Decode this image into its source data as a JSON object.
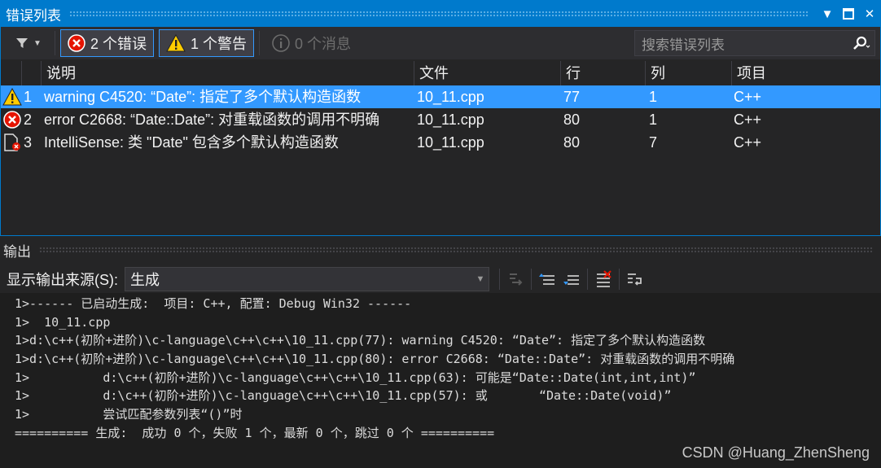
{
  "error_list": {
    "title": "错误列表",
    "filters": {
      "errors_label": "2 个错误",
      "warnings_label": "1 个警告",
      "messages_label": "0 个消息"
    },
    "search": {
      "placeholder": "搜索错误列表"
    },
    "columns": [
      "说明",
      "文件",
      "行",
      "列",
      "项目"
    ],
    "rows": [
      {
        "icon": "warning-icon",
        "num": "1",
        "desc": "warning C4520: “Date”: 指定了多个默认构造函数",
        "file": "10_11.cpp",
        "line": "77",
        "col": "1",
        "project": "C++"
      },
      {
        "icon": "error-icon",
        "num": "2",
        "desc": "error C2668: “Date::Date”: 对重载函数的调用不明确",
        "file": "10_11.cpp",
        "line": "80",
        "col": "1",
        "project": "C++"
      },
      {
        "icon": "intellisense-error-icon",
        "num": "3",
        "desc": "IntelliSense:  类 \"Date\" 包含多个默认构造函数",
        "file": "10_11.cpp",
        "line": "80",
        "col": "7",
        "project": "C++"
      }
    ]
  },
  "output": {
    "title": "输出",
    "source_label": "显示输出来源(S):",
    "source_value": "生成",
    "lines": [
      "1>------ 已启动生成:  项目: C++, 配置: Debug Win32 ------",
      "1>  10_11.cpp",
      "1>d:\\c++(初阶+进阶)\\c-language\\c++\\c++\\10_11.cpp(77): warning C4520: “Date”: 指定了多个默认构造函数",
      "1>d:\\c++(初阶+进阶)\\c-language\\c++\\c++\\10_11.cpp(80): error C2668: “Date::Date”: 对重载函数的调用不明确",
      "1>          d:\\c++(初阶+进阶)\\c-language\\c++\\c++\\10_11.cpp(63): 可能是“Date::Date(int,int,int)”",
      "1>          d:\\c++(初阶+进阶)\\c-language\\c++\\c++\\10_11.cpp(57): 或       “Date::Date(void)”",
      "1>          尝试匹配参数列表“()”时",
      "========== 生成:  成功 0 个，失败 1 个，最新 0 个，跳过 0 个 =========="
    ]
  },
  "watermark": "CSDN @Huang_ZhenSheng",
  "colors": {
    "accent": "#007acc",
    "selection": "#3399ff",
    "error": "#e51400",
    "warning": "#ffcc00"
  }
}
